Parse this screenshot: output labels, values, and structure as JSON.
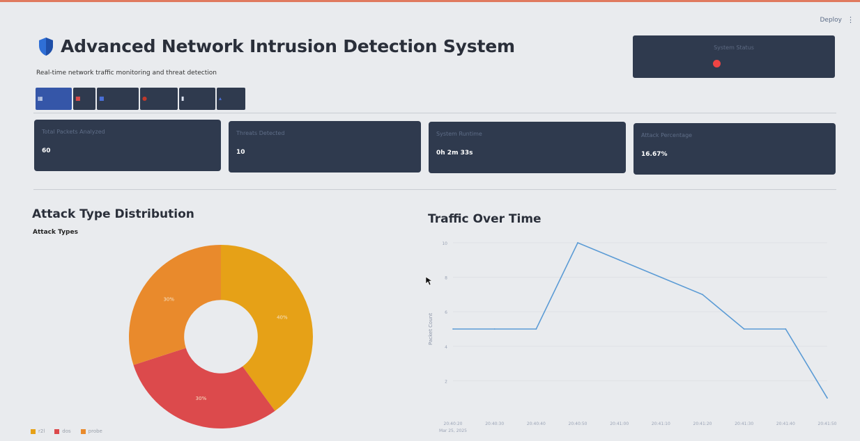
{
  "header": {
    "title": "Advanced Network Intrusion Detection System",
    "subtitle": "Real-time network traffic monitoring and threat detection",
    "deploy_label": "Deploy",
    "menu_icon": "kebab-menu-icon",
    "title_icon": "shield-icon"
  },
  "system_status": {
    "label": "System Status",
    "indicator_color": "#ef4444"
  },
  "metrics": [
    {
      "label": "Total Packets Analyzed",
      "value": "60"
    },
    {
      "label": "Threats Detected",
      "value": "10"
    },
    {
      "label": "System Runtime",
      "value": "0h 2m 33s"
    },
    {
      "label": "Attack Percentage",
      "value": "16.67%"
    }
  ],
  "sections": {
    "attack_dist_title": "Attack Type Distribution",
    "attack_dist_legend_title": "Attack Types",
    "traffic_title": "Traffic Over Time"
  },
  "colors": {
    "panel": "#2f3a4e",
    "accent": "#3556a8",
    "line": "#5b9bd5"
  },
  "chart_data": [
    {
      "type": "pie",
      "title": "Attack Type Distribution",
      "legend_title": "Attack Types",
      "categories": [
        "r2l",
        "dos",
        "probe"
      ],
      "values": [
        40,
        30,
        30
      ],
      "labels": [
        "40%",
        "30%",
        "30%"
      ],
      "colors": [
        "#e6a117",
        "#dc4a4c",
        "#e98a2c"
      ],
      "hole": 0.4,
      "legend_position": "bottom-left"
    },
    {
      "type": "line",
      "title": "Traffic Over Time",
      "ylabel": "Packet Count",
      "x": [
        "20:40:20",
        "20:40:30",
        "20:40:40",
        "20:40:50",
        "20:41:00",
        "20:41:10",
        "20:41:20",
        "20:41:30",
        "20:41:40",
        "20:41:50"
      ],
      "x_sublabel": "Mar 25, 2025",
      "y": [
        5,
        5,
        5,
        10,
        9,
        8,
        7,
        5,
        5,
        1
      ],
      "ylim": [
        0,
        10
      ],
      "yticks": [
        2,
        4,
        6,
        8,
        10
      ],
      "color": "#5b9bd5",
      "grid": true
    }
  ]
}
